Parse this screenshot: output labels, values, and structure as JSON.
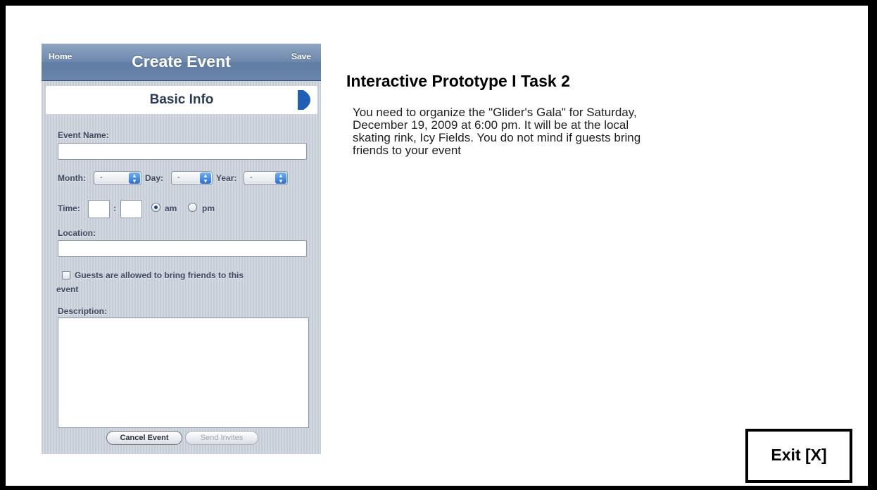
{
  "phone": {
    "nav": {
      "home": "Home",
      "title": "Create Event",
      "save": "Save"
    },
    "section": {
      "title": "Basic Info",
      "icon": "chevron-right-icon"
    },
    "form": {
      "event_name_label": "Event Name:",
      "event_name_value": "",
      "month_label": "Month:",
      "month_value": "-",
      "day_label": "Day:",
      "day_value": "-",
      "year_label": "Year:",
      "year_value": "-",
      "time_label": "Time:",
      "time_sep": ":",
      "am_label": "am",
      "pm_label": "pm",
      "selected_period": "am",
      "location_label": "Location:",
      "location_value": "",
      "guests_label_line1": "Guests are allowed to bring friends to this",
      "guests_label_line2": "event",
      "guests_checked": false,
      "description_label": "Description:",
      "description_value": ""
    },
    "buttons": {
      "cancel": "Cancel Event",
      "send": "Send Invites"
    }
  },
  "task": {
    "title": "Interactive Prototype I Task 2",
    "text": "You need to organize the \"Glider's Gala\" for Saturday, December 19, 2009 at 6:00 pm. It will be at the local skating rink, Icy Fields. You do not mind if guests bring friends to your event"
  },
  "exit_label": "Exit [X]",
  "colors": {
    "nav": "#6d88ad",
    "accent": "#2a6ed8",
    "arrow": "#1f5fb8"
  }
}
